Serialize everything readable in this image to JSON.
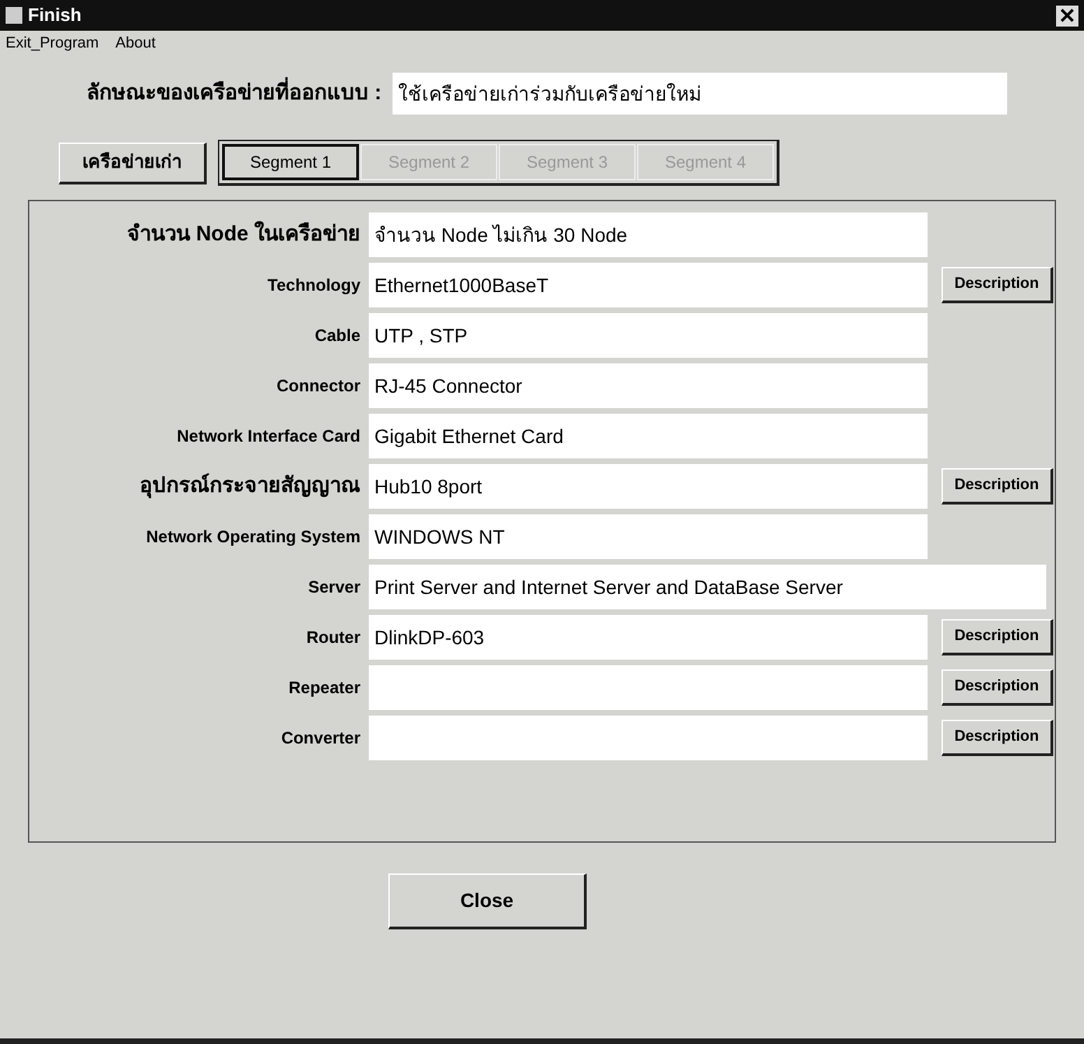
{
  "window": {
    "title": "Finish"
  },
  "menu": [
    "Exit_Program",
    "About"
  ],
  "design": {
    "label": "ลักษณะของเครือข่ายที่ออกแบบ :",
    "value": "ใช้เครือข่ายเก่าร่วมกับเครือข่ายใหม่"
  },
  "old_network_button": "เครือข่ายเก่า",
  "tabs": [
    {
      "label": "Segment 1",
      "selected": true,
      "disabled": false
    },
    {
      "label": "Segment 2",
      "selected": false,
      "disabled": true
    },
    {
      "label": "Segment 3",
      "selected": false,
      "disabled": true
    },
    {
      "label": "Segment 4",
      "selected": false,
      "disabled": true
    }
  ],
  "rows": [
    {
      "label": "จำนวน Node ในเครือข่าย",
      "value": "จำนวน Node  ไม่เกิน  30 Node",
      "large_label": true,
      "wide": false
    },
    {
      "label": "Technology",
      "value": "Ethernet1000BaseT",
      "button": "Description",
      "large_label": false,
      "wide": false
    },
    {
      "label": "Cable",
      "value": "UTP , STP",
      "large_label": false,
      "wide": false
    },
    {
      "label": "Connector",
      "value": "RJ-45 Connector",
      "large_label": false,
      "wide": false
    },
    {
      "label": "Network Interface Card",
      "value": "Gigabit Ethernet Card",
      "large_label": false,
      "wide": false
    },
    {
      "label": "อุปกรณ์กระจายสัญญาณ",
      "value": "Hub10 8port",
      "button": "Description",
      "large_label": true,
      "wide": false
    },
    {
      "label": "Network Operating System",
      "value": "WINDOWS NT",
      "large_label": false,
      "wide": false
    },
    {
      "label": "Server",
      "value": "Print Server  and Internet Server and DataBase Server",
      "large_label": false,
      "wide": true
    },
    {
      "label": "Router",
      "value": "DlinkDP-603",
      "button": "Description",
      "large_label": false,
      "wide": false
    },
    {
      "label": "Repeater",
      "button": "Description",
      "large_label": false,
      "wide": false
    },
    {
      "label": "Converter",
      "button": "Description",
      "large_label": false,
      "wide": false
    }
  ],
  "close_button": "Close"
}
